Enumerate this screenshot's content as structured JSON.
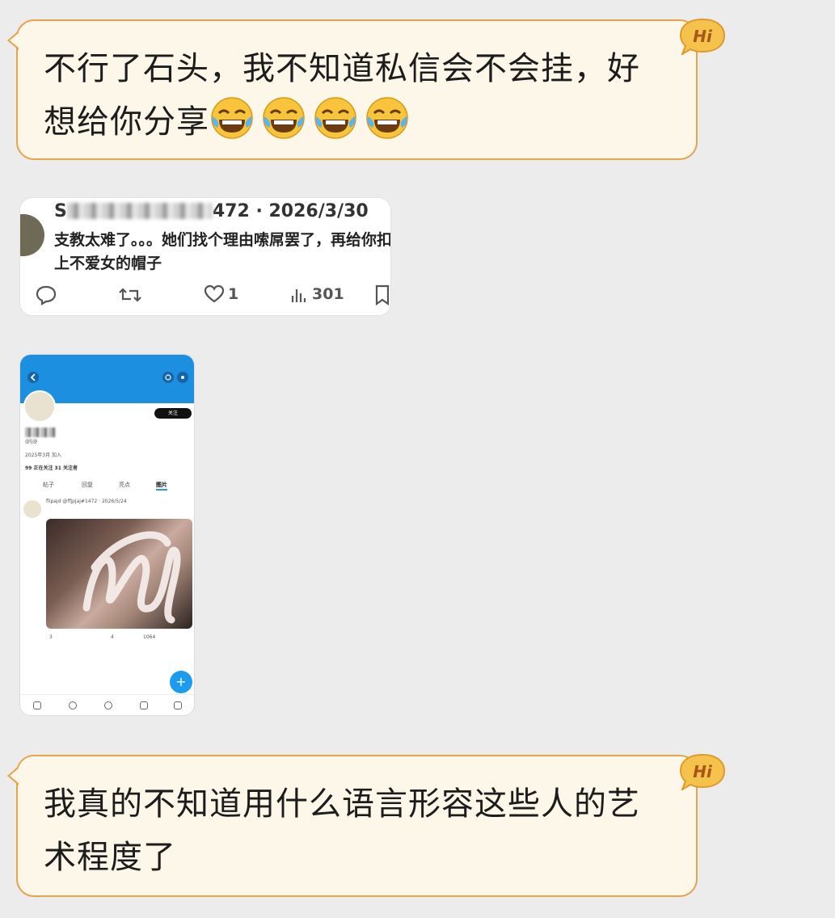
{
  "messages": [
    {
      "text": "不行了石头，我不知道私信会不会挂，好想给你分享",
      "emoji": [
        "face-with-tears-of-joy",
        "face-with-tears-of-joy",
        "face-with-tears-of-joy",
        "face-with-tears-of-joy"
      ],
      "badge": "Hi"
    },
    {
      "text": "我真的不知道用什么语言形容这些人的艺术程度了",
      "badge": "Hi"
    }
  ],
  "tweet_card": {
    "handle_prefix": "S",
    "handle_suffix": "472 · 2026/3/30",
    "text": "支教太难了。。。她们找个理由嗦屌罢了，再给你扣上不爱女的帽子",
    "likes": "1",
    "views": "301"
  },
  "phone_screenshot": {
    "handle": "@lj@",
    "joined": "2025年3月 加入",
    "stats": "99 正在关注   31 关注者",
    "tabs": [
      "帖子",
      "回复",
      "亮点",
      "图片"
    ],
    "post_header": "flipajd @ffjpjaj#1472 · 2026/5/24",
    "post_counts": [
      "3",
      "4",
      "1064"
    ],
    "fab_label": "+",
    "follow_label": "关注"
  },
  "colors": {
    "bubble_bg": "#fdf7ea",
    "bubble_border": "#e5a44a",
    "badge": "#f5c24c",
    "twitter_blue": "#1d9bf0"
  }
}
